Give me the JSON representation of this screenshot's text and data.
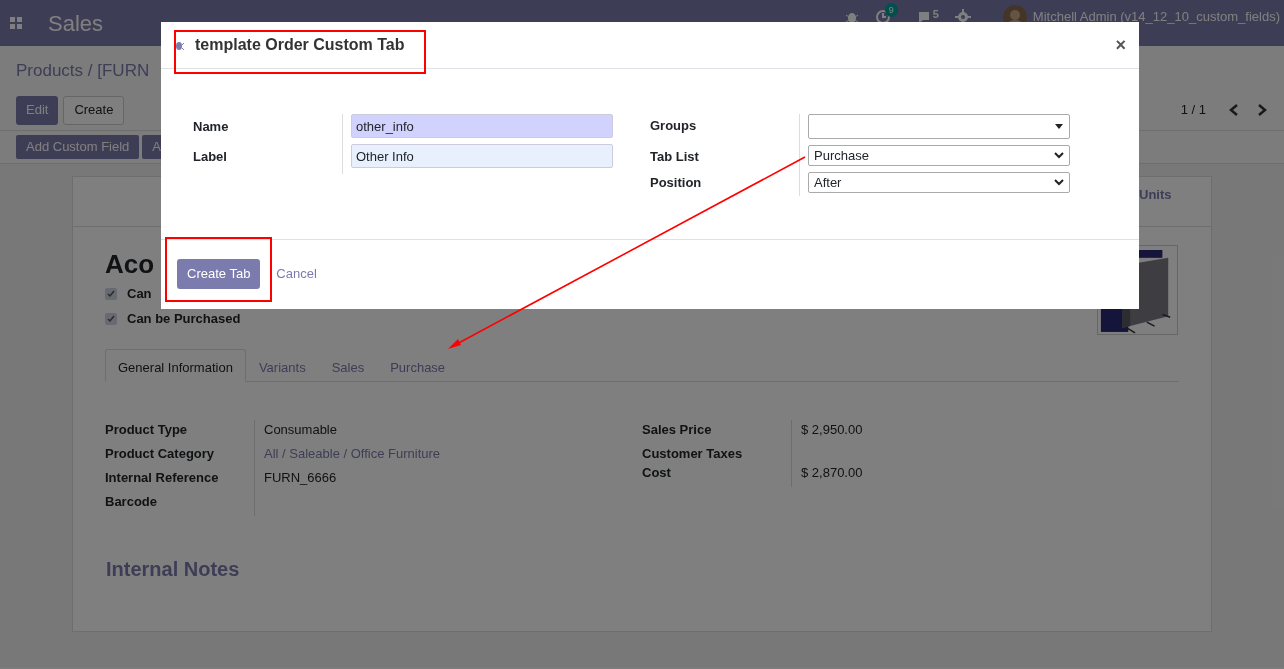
{
  "navbar": {
    "app": "Sales",
    "activity_count": "9",
    "chat_count": "5",
    "user": "Mitchell Admin (v14_12_10_custom_fields)"
  },
  "breadcrumb": "Products / [FURN",
  "buttons": [
    "Edit",
    "Create"
  ],
  "pager": "1 / 1",
  "custom_buttons": [
    "Add Custom Field",
    "A"
  ],
  "product": {
    "stat_lines": [
      "Units"
    ],
    "title": "Aco",
    "checks": [
      {
        "label": "Can",
        "checked": true
      },
      {
        "label": "Can be Purchased",
        "checked": true
      }
    ],
    "tabs": [
      {
        "label": "General Information",
        "selected": true
      },
      {
        "label": "Variants",
        "selected": false
      },
      {
        "label": "Sales",
        "selected": false
      },
      {
        "label": "Purchase",
        "selected": false
      }
    ],
    "left_fields": [
      {
        "label": "Product Type",
        "value": "Consumable",
        "kind": "text"
      },
      {
        "label": "Product Category",
        "value": "All / Saleable / Office Furniture",
        "kind": "link"
      },
      {
        "label": "Internal Reference",
        "value": "FURN_6666",
        "kind": "text"
      },
      {
        "label": "Barcode"
      }
    ],
    "right_fields": [
      {
        "label": "Sales Price",
        "value": "$ 2,950.00"
      },
      {
        "label": "Customer Taxes"
      },
      {
        "label": "Cost",
        "value": "$ 2,870.00"
      }
    ],
    "notes_heading": "Internal Notes"
  },
  "dialog": {
    "title": "template Order Custom Tab",
    "close": "×",
    "left_fields": [
      {
        "label": "Name",
        "value": "other_info",
        "required": true
      },
      {
        "label": "Label",
        "value": "Other Info",
        "required": false
      }
    ],
    "right_fields": [
      {
        "label": "Groups",
        "kind": "many2one"
      },
      {
        "label": "Tab List",
        "kind": "select",
        "value": "Purchase"
      },
      {
        "label": "Position",
        "kind": "select",
        "value": "After"
      }
    ],
    "primary": "Create Tab",
    "secondary": "Cancel"
  }
}
